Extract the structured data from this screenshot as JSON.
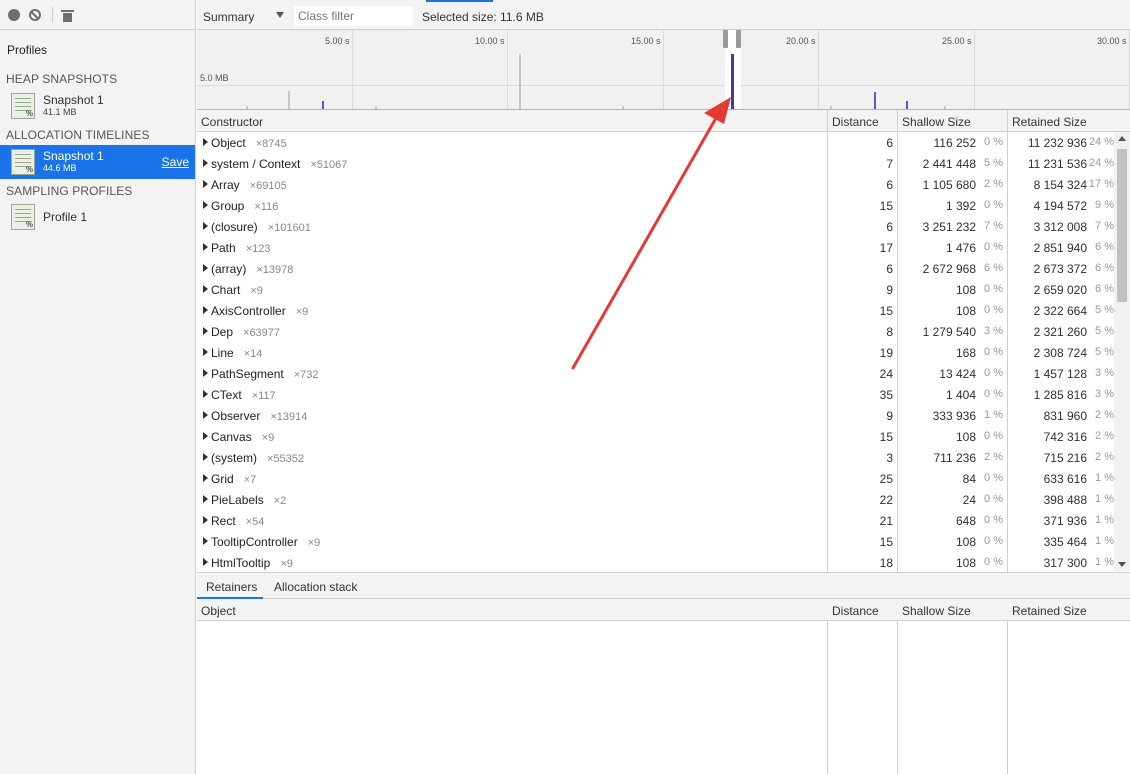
{
  "sidebar": {
    "toolbar": {
      "record_icon": "record-icon",
      "clear_icon": "clear-icon",
      "delete_icon": "trash-icon"
    },
    "title": "Profiles",
    "sections": [
      {
        "title": "HEAP SNAPSHOTS",
        "items": [
          {
            "name": "Snapshot 1",
            "size": "41.1 MB"
          }
        ]
      },
      {
        "title": "ALLOCATION TIMELINES",
        "items": [
          {
            "name": "Snapshot 1",
            "size": "44.6 MB",
            "selected": true,
            "action": "Save"
          }
        ]
      },
      {
        "title": "SAMPLING PROFILES",
        "items": [
          {
            "name": "Profile 1",
            "size": ""
          }
        ]
      }
    ]
  },
  "toolbar": {
    "view": "Summary",
    "class_filter_placeholder": "Class filter",
    "selected_size": "Selected size: 11.6 MB"
  },
  "timeline": {
    "ticks": [
      "5.00 s",
      "10.00 s",
      "15.00 s",
      "20.00 s",
      "25.00 s",
      "30.00 s"
    ],
    "memory_label": "5.0 MB"
  },
  "table": {
    "headers": {
      "constructor": "Constructor",
      "distance": "Distance",
      "shallow": "Shallow Size",
      "retained": "Retained Size"
    },
    "rows": [
      {
        "name": "Object",
        "count": "×8745",
        "distance": "6",
        "shallow": "116 252",
        "shallow_pct": "0 %",
        "retained": "11 232 936",
        "retained_pct": "24 %"
      },
      {
        "name": "system / Context",
        "count": "×51067",
        "distance": "7",
        "shallow": "2 441 448",
        "shallow_pct": "5 %",
        "retained": "11 231 536",
        "retained_pct": "24 %"
      },
      {
        "name": "Array",
        "count": "×69105",
        "distance": "6",
        "shallow": "1 105 680",
        "shallow_pct": "2 %",
        "retained": "8 154 324",
        "retained_pct": "17 %"
      },
      {
        "name": "Group",
        "count": "×116",
        "distance": "15",
        "shallow": "1 392",
        "shallow_pct": "0 %",
        "retained": "4 194 572",
        "retained_pct": "9 %"
      },
      {
        "name": "(closure)",
        "count": "×101601",
        "distance": "6",
        "shallow": "3 251 232",
        "shallow_pct": "7 %",
        "retained": "3 312 008",
        "retained_pct": "7 %"
      },
      {
        "name": "Path",
        "count": "×123",
        "distance": "17",
        "shallow": "1 476",
        "shallow_pct": "0 %",
        "retained": "2 851 940",
        "retained_pct": "6 %"
      },
      {
        "name": "(array)",
        "count": "×13978",
        "distance": "6",
        "shallow": "2 672 968",
        "shallow_pct": "6 %",
        "retained": "2 673 372",
        "retained_pct": "6 %"
      },
      {
        "name": "Chart",
        "count": "×9",
        "distance": "9",
        "shallow": "108",
        "shallow_pct": "0 %",
        "retained": "2 659 020",
        "retained_pct": "6 %"
      },
      {
        "name": "AxisController",
        "count": "×9",
        "distance": "15",
        "shallow": "108",
        "shallow_pct": "0 %",
        "retained": "2 322 664",
        "retained_pct": "5 %"
      },
      {
        "name": "Dep",
        "count": "×63977",
        "distance": "8",
        "shallow": "1 279 540",
        "shallow_pct": "3 %",
        "retained": "2 321 260",
        "retained_pct": "5 %"
      },
      {
        "name": "Line",
        "count": "×14",
        "distance": "19",
        "shallow": "168",
        "shallow_pct": "0 %",
        "retained": "2 308 724",
        "retained_pct": "5 %"
      },
      {
        "name": "PathSegment",
        "count": "×732",
        "distance": "24",
        "shallow": "13 424",
        "shallow_pct": "0 %",
        "retained": "1 457 128",
        "retained_pct": "3 %"
      },
      {
        "name": "CText",
        "count": "×117",
        "distance": "35",
        "shallow": "1 404",
        "shallow_pct": "0 %",
        "retained": "1 285 816",
        "retained_pct": "3 %"
      },
      {
        "name": "Observer",
        "count": "×13914",
        "distance": "9",
        "shallow": "333 936",
        "shallow_pct": "1 %",
        "retained": "831 960",
        "retained_pct": "2 %"
      },
      {
        "name": "Canvas",
        "count": "×9",
        "distance": "15",
        "shallow": "108",
        "shallow_pct": "0 %",
        "retained": "742 316",
        "retained_pct": "2 %"
      },
      {
        "name": "(system)",
        "count": "×55352",
        "distance": "3",
        "shallow": "711 236",
        "shallow_pct": "2 %",
        "retained": "715 216",
        "retained_pct": "2 %"
      },
      {
        "name": "Grid",
        "count": "×7",
        "distance": "25",
        "shallow": "84",
        "shallow_pct": "0 %",
        "retained": "633 616",
        "retained_pct": "1 %"
      },
      {
        "name": "PieLabels",
        "count": "×2",
        "distance": "22",
        "shallow": "24",
        "shallow_pct": "0 %",
        "retained": "398 488",
        "retained_pct": "1 %"
      },
      {
        "name": "Rect",
        "count": "×54",
        "distance": "21",
        "shallow": "648",
        "shallow_pct": "0 %",
        "retained": "371 936",
        "retained_pct": "1 %"
      },
      {
        "name": "TooltipController",
        "count": "×9",
        "distance": "15",
        "shallow": "108",
        "shallow_pct": "0 %",
        "retained": "335 464",
        "retained_pct": "1 %"
      },
      {
        "name": "HtmlTooltip",
        "count": "×9",
        "distance": "18",
        "shallow": "108",
        "shallow_pct": "0 %",
        "retained": "317 300",
        "retained_pct": "1 %"
      }
    ]
  },
  "bottom": {
    "tabs": [
      "Retainers",
      "Allocation stack"
    ],
    "headers": {
      "object": "Object",
      "distance": "Distance",
      "shallow": "Shallow Size",
      "retained": "Retained Size"
    }
  },
  "colors": {
    "accent": "#1a73e8",
    "annotation_arrow": "#e53935",
    "timeline_bar": "#5a5ad8"
  }
}
